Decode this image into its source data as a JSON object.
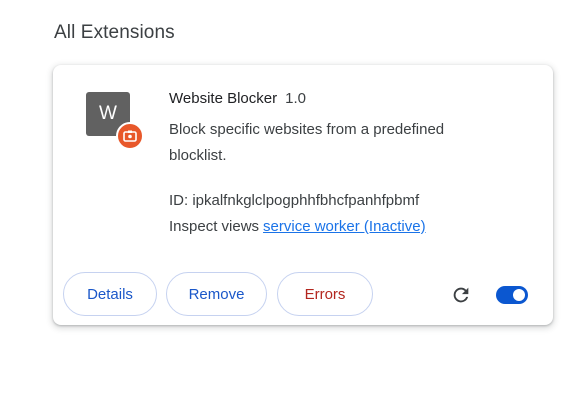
{
  "section": {
    "title": "All Extensions"
  },
  "extension": {
    "icon_letter": "W",
    "badge_icon": "unpacked-extension-icon",
    "name": "Website Blocker",
    "version": "1.0",
    "description": "Block specific websites from a predefined blocklist.",
    "id_text": "ID: ipkalfnkglclpogphhfbhcfpanhfpbmf",
    "inspect_label": "Inspect views",
    "inspect_link": "service worker (Inactive)",
    "enabled": true
  },
  "actions": {
    "details_label": "Details",
    "remove_label": "Remove",
    "errors_label": "Errors",
    "reload_icon": "reload-icon"
  },
  "colors": {
    "accent": "#0b57d0",
    "link": "#1a73e8",
    "error": "#b3261e",
    "badge": "#e8582a",
    "icon_bg": "#616161"
  }
}
